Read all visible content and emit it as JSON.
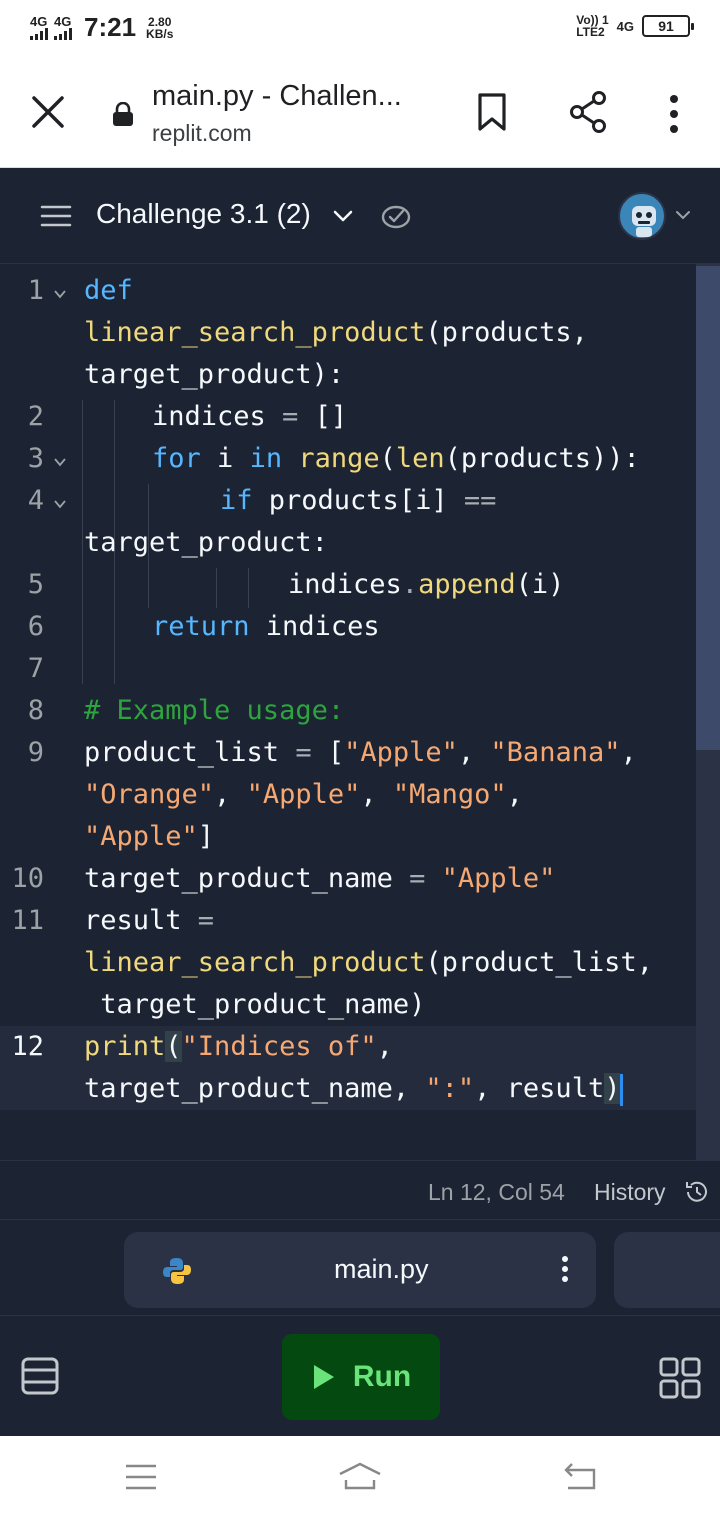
{
  "status_bar": {
    "network1": "4G",
    "network2": "4G",
    "time": "7:21",
    "speed_value": "2.80",
    "speed_unit": "KB/s",
    "volte_line1": "Vo)) 1",
    "volte_line2": "LTE2",
    "net3": "4G",
    "battery": "91"
  },
  "browser": {
    "page_title": "main.py - Challen...",
    "domain": "replit.com",
    "icons": [
      "close-icon",
      "lock-icon",
      "bookmark-icon",
      "share-icon",
      "more-vertical-icon"
    ]
  },
  "replit": {
    "repl_name": "Challenge 3.1 (2)",
    "icons": [
      "menu-icon",
      "chevron-down-icon",
      "cloud-check-icon",
      "avatar",
      "chevron-down-icon"
    ]
  },
  "editor": {
    "line_numbers": [
      "1",
      "2",
      "3",
      "4",
      "5",
      "6",
      "7",
      "8",
      "9",
      "10",
      "11",
      "12"
    ],
    "rows": [
      {
        "ln": "1",
        "text": "def"
      },
      {
        "text": "linear_search_product(products,"
      },
      {
        "text": "target_product):"
      },
      {
        "ln": "2",
        "text": "indices = []"
      },
      {
        "ln": "3",
        "text": "for i in range(len(products)):"
      },
      {
        "ln": "4",
        "text": "if products[i] =="
      },
      {
        "text": "target_product:"
      },
      {
        "ln": "5",
        "text": "indices.append(i)"
      },
      {
        "ln": "6",
        "text": "return indices"
      },
      {
        "ln": "7",
        "text": ""
      },
      {
        "ln": "8",
        "text": "# Example usage:"
      },
      {
        "ln": "9",
        "text": "product_list = [\"Apple\", \"Banana\","
      },
      {
        "text": "\"Orange\", \"Apple\", \"Mango\","
      },
      {
        "text": "\"Apple\"]"
      },
      {
        "ln": "10",
        "text": "target_product_name = \"Apple\""
      },
      {
        "ln": "11",
        "text": "result ="
      },
      {
        "text": "linear_search_product(product_list,"
      },
      {
        "text": " target_product_name)"
      },
      {
        "ln": "12",
        "text": "print(\"Indices of\","
      },
      {
        "text": "target_product_name, \":\", result)"
      }
    ],
    "colors": {
      "keyword": "#56b6ff",
      "function": "#f0d97c",
      "string": "#f6a873",
      "comment": "#2ea43e",
      "text": "#f5f9fc",
      "background": "#1c2333"
    }
  },
  "footer": {
    "cursor_position": "Ln 12, Col 54",
    "history_label": "History"
  },
  "tabs": {
    "active_file": "main.py"
  },
  "toolbar": {
    "run_label": "Run",
    "run_color": "#044a10"
  }
}
